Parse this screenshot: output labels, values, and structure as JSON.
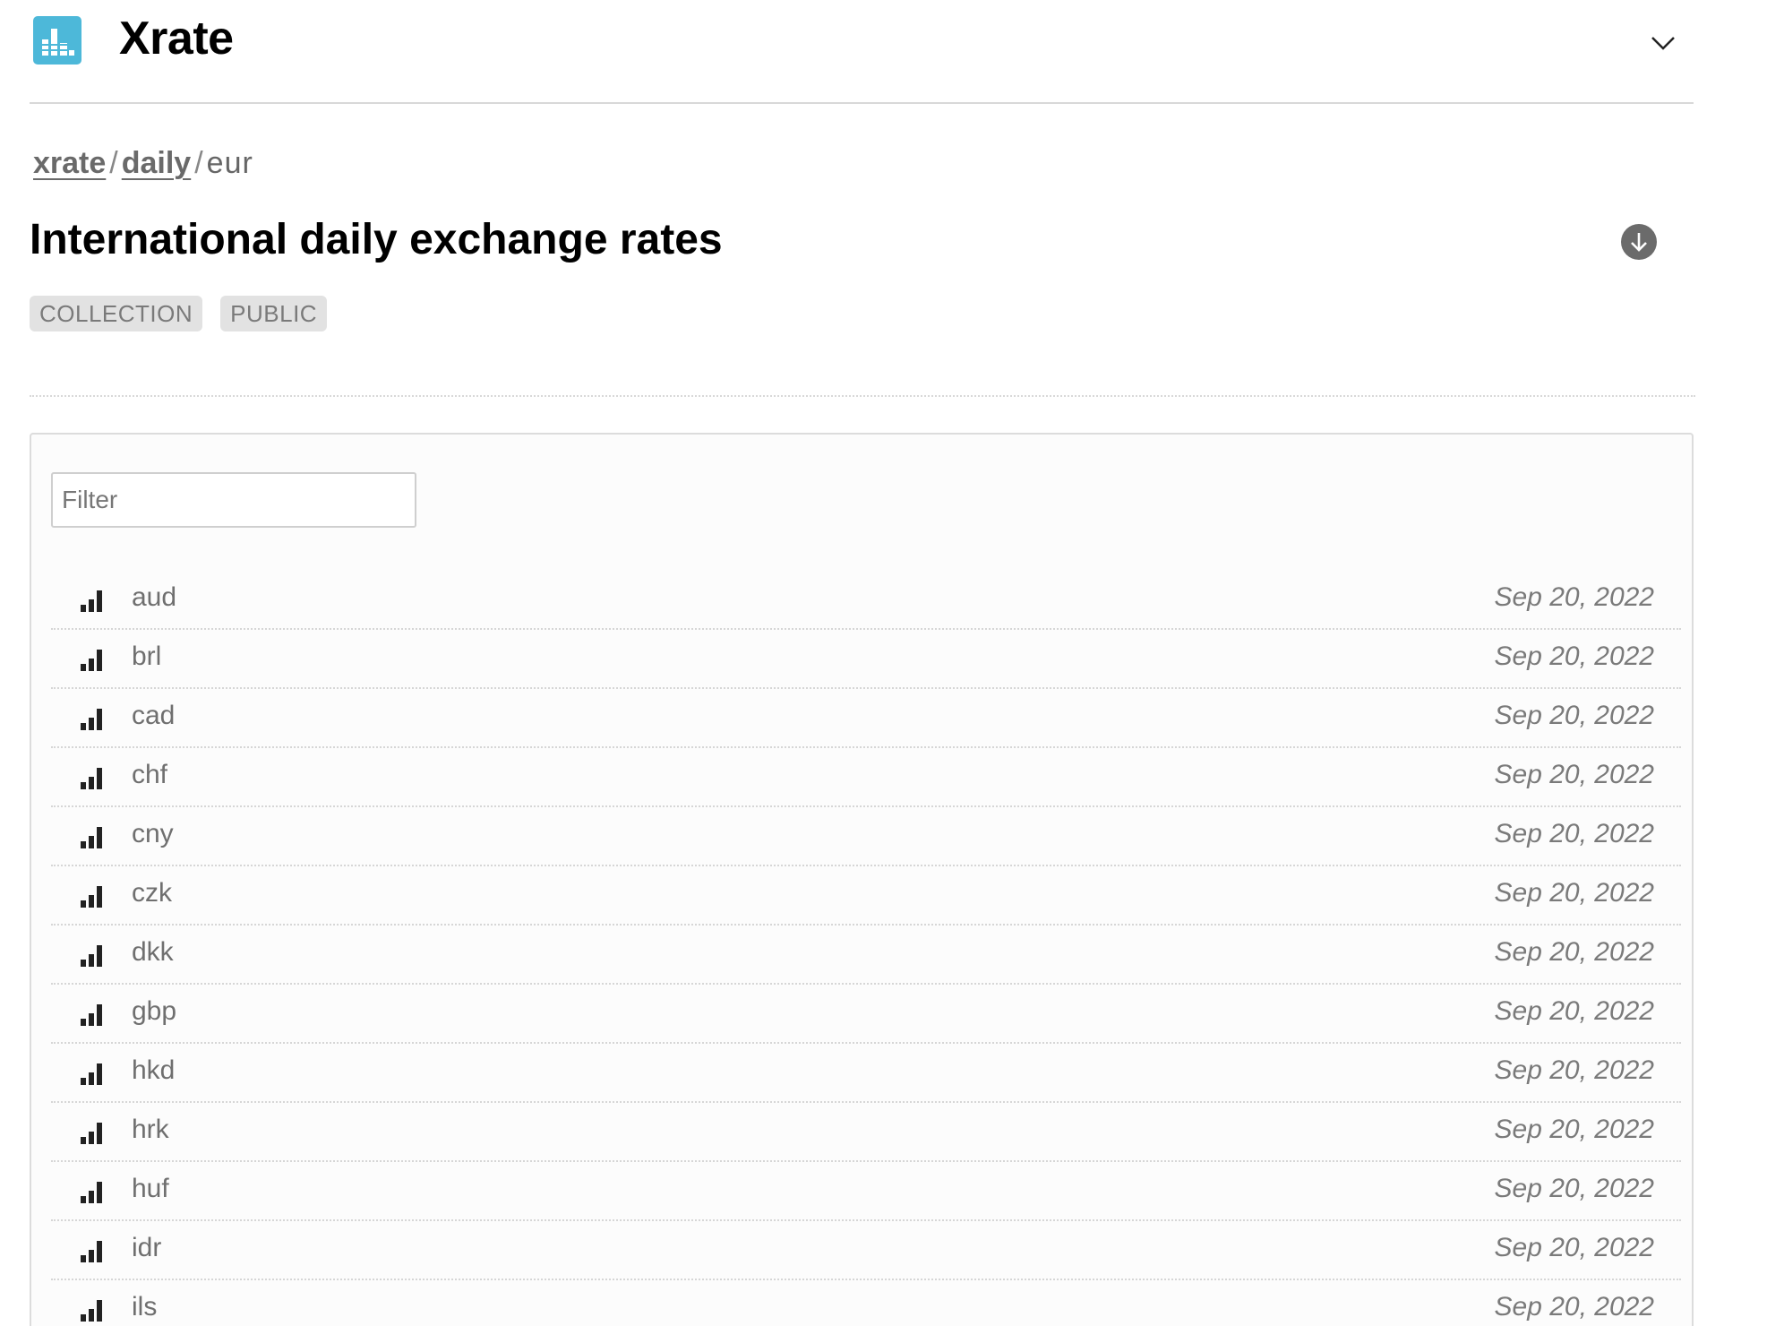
{
  "header": {
    "brand": "Xrate",
    "logo_icon": "bar-chart-logo-icon",
    "menu_icon": "chevron-down-icon",
    "accent_color": "#4db8d9"
  },
  "breadcrumb": {
    "items": [
      {
        "label": "xrate",
        "link": true
      },
      {
        "label": "daily",
        "link": true
      },
      {
        "label": "eur",
        "link": false
      }
    ],
    "separator": "/"
  },
  "page": {
    "title": "International daily exchange rates",
    "download_icon": "download-icon",
    "badges": [
      "COLLECTION",
      "PUBLIC"
    ]
  },
  "filter": {
    "placeholder": "Filter",
    "value": ""
  },
  "list": {
    "row_icon": "signal-bars-icon",
    "items": [
      {
        "code": "aud",
        "date": "Sep 20, 2022"
      },
      {
        "code": "brl",
        "date": "Sep 20, 2022"
      },
      {
        "code": "cad",
        "date": "Sep 20, 2022"
      },
      {
        "code": "chf",
        "date": "Sep 20, 2022"
      },
      {
        "code": "cny",
        "date": "Sep 20, 2022"
      },
      {
        "code": "czk",
        "date": "Sep 20, 2022"
      },
      {
        "code": "dkk",
        "date": "Sep 20, 2022"
      },
      {
        "code": "gbp",
        "date": "Sep 20, 2022"
      },
      {
        "code": "hkd",
        "date": "Sep 20, 2022"
      },
      {
        "code": "hrk",
        "date": "Sep 20, 2022"
      },
      {
        "code": "huf",
        "date": "Sep 20, 2022"
      },
      {
        "code": "idr",
        "date": "Sep 20, 2022"
      },
      {
        "code": "ils",
        "date": "Sep 20, 2022"
      }
    ]
  }
}
